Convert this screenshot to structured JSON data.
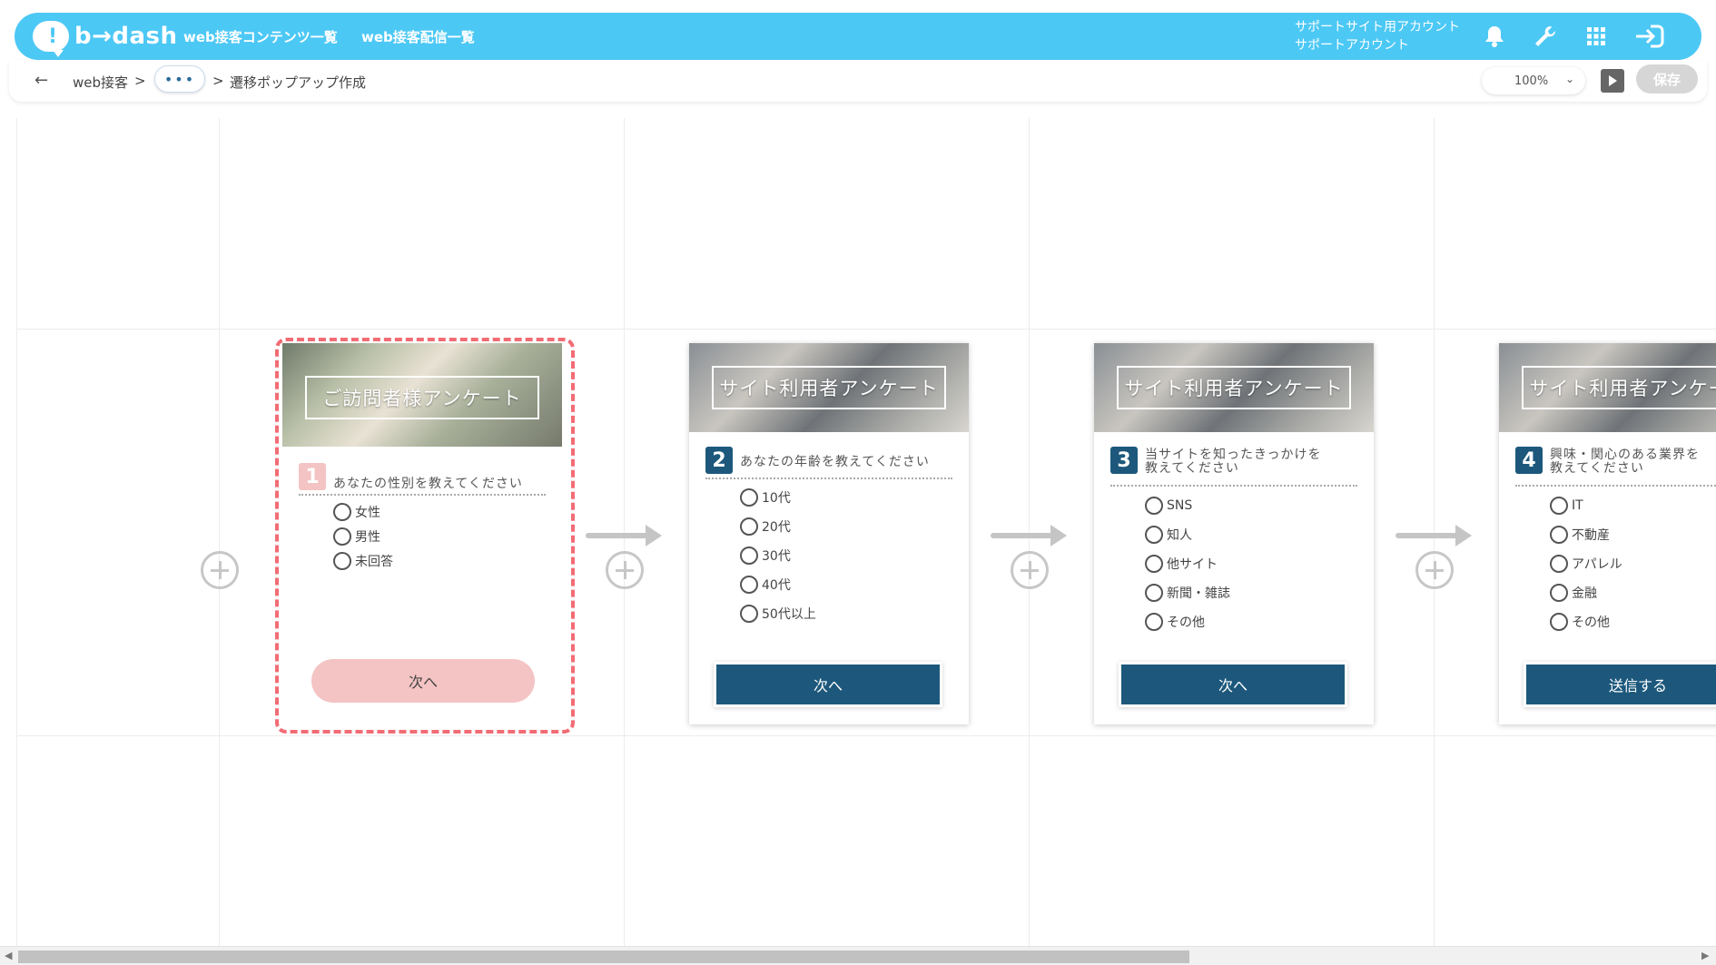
{
  "app": {
    "logo_text": "b→dash",
    "nav": [
      "web接客コンテンツ一覧",
      "web接客配信一覧"
    ],
    "account_line1": "サポートサイト用アカウント",
    "account_line2": "サポートアカウント",
    "accent_color": "#4cc8f5",
    "icons": [
      "bell-icon",
      "wrench-icon",
      "grid-icon",
      "logout-icon"
    ]
  },
  "breadcrumb": {
    "back_icon": "←",
    "root": "web接客",
    "sep1": ">",
    "more": "•••",
    "sep2": ">",
    "current": "遷移ポップアップ作成"
  },
  "toolbar": {
    "zoom": "100%",
    "save_label": "保存"
  },
  "cards": [
    {
      "title": "ご訪問者様アンケート",
      "number": "1",
      "question": "あなたの性別を教えてください",
      "options": [
        "女性",
        "男性",
        "未回答"
      ],
      "button": "次へ",
      "selected": true,
      "number_color": "#f4c3c3"
    },
    {
      "title": "サイト利用者アンケート",
      "number": "2",
      "question": "あなたの年齢を教えてください",
      "options": [
        "10代",
        "20代",
        "30代",
        "40代",
        "50代以上"
      ],
      "button": "次へ",
      "number_color": "#1d587c"
    },
    {
      "title": "サイト利用者アンケート",
      "number": "3",
      "question_line1": "当サイトを知ったきっかけを",
      "question_line2": "教えてください",
      "options": [
        "SNS",
        "知人",
        "他サイト",
        "新聞・雑誌",
        "その他"
      ],
      "button": "次へ",
      "number_color": "#1d587c"
    },
    {
      "title": "サイト利用者アンケート",
      "number": "4",
      "question_line1": "興味・関心のある業界を",
      "question_line2": "教えてください",
      "options": [
        "IT",
        "不動産",
        "アパレル",
        "金融",
        "その他"
      ],
      "button": "送信する",
      "number_color": "#1d587c"
    }
  ]
}
